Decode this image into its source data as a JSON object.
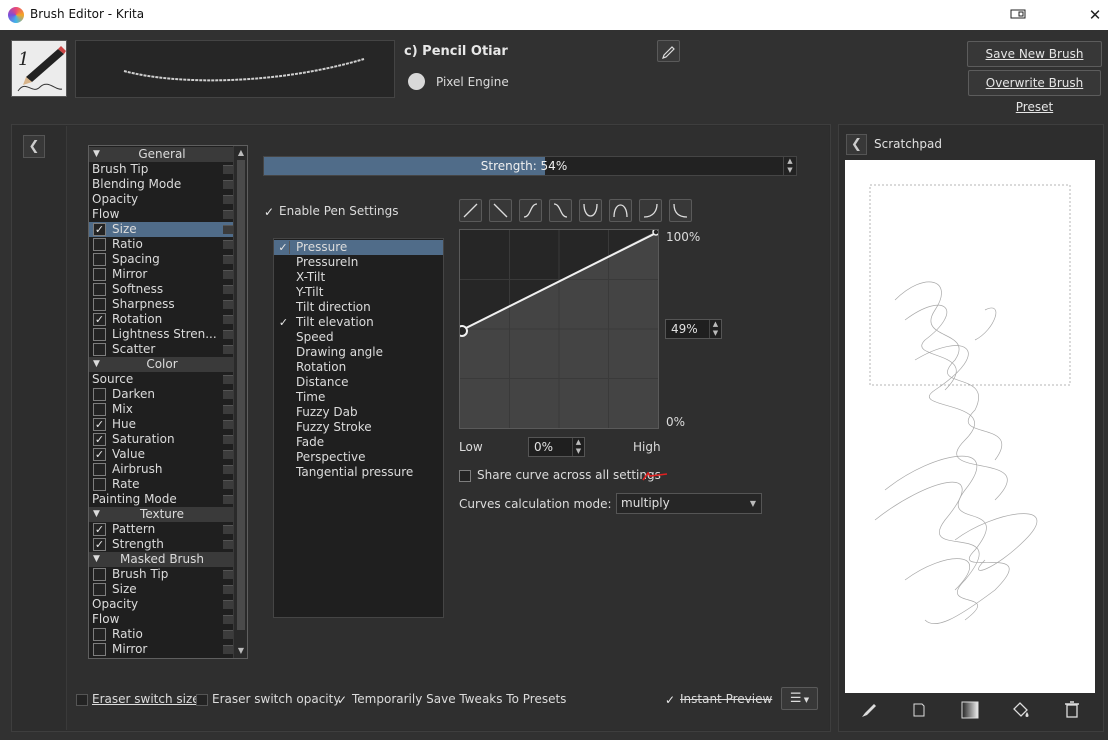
{
  "window": {
    "title": "Brush Editor - Krita"
  },
  "preset": {
    "name": "c) Pencil Otiar",
    "engine": "Pixel Engine",
    "save_new_label": "Save New Brush Preset...",
    "overwrite_label": "Overwrite Brush Preset"
  },
  "options": [
    {
      "type": "header",
      "label": "General"
    },
    {
      "type": "item",
      "label": "Brush Tip",
      "cb": null
    },
    {
      "type": "item",
      "label": "Blending Mode",
      "cb": null
    },
    {
      "type": "item",
      "label": "Opacity",
      "cb": null
    },
    {
      "type": "item",
      "label": "Flow",
      "cb": null
    },
    {
      "type": "item",
      "label": "Size",
      "cb": true,
      "selected": true
    },
    {
      "type": "item",
      "label": "Ratio",
      "cb": false
    },
    {
      "type": "item",
      "label": "Spacing",
      "cb": false
    },
    {
      "type": "item",
      "label": "Mirror",
      "cb": false
    },
    {
      "type": "item",
      "label": "Softness",
      "cb": false
    },
    {
      "type": "item",
      "label": "Sharpness",
      "cb": false
    },
    {
      "type": "item",
      "label": "Rotation",
      "cb": true
    },
    {
      "type": "item",
      "label": "Lightness Stren...",
      "cb": false
    },
    {
      "type": "item",
      "label": "Scatter",
      "cb": false
    },
    {
      "type": "header",
      "label": "Color"
    },
    {
      "type": "item",
      "label": "Source",
      "cb": null
    },
    {
      "type": "item",
      "label": "Darken",
      "cb": false
    },
    {
      "type": "item",
      "label": "Mix",
      "cb": false
    },
    {
      "type": "item",
      "label": "Hue",
      "cb": true
    },
    {
      "type": "item",
      "label": "Saturation",
      "cb": true
    },
    {
      "type": "item",
      "label": "Value",
      "cb": true
    },
    {
      "type": "item",
      "label": "Airbrush",
      "cb": false
    },
    {
      "type": "item",
      "label": "Rate",
      "cb": false
    },
    {
      "type": "item",
      "label": "Painting Mode",
      "cb": null
    },
    {
      "type": "header",
      "label": "Texture"
    },
    {
      "type": "item",
      "label": "Pattern",
      "cb": true
    },
    {
      "type": "item",
      "label": "Strength",
      "cb": true
    },
    {
      "type": "header",
      "label": "Masked Brush"
    },
    {
      "type": "item",
      "label": "Brush Tip",
      "cb": false
    },
    {
      "type": "item",
      "label": "Size",
      "cb": false
    },
    {
      "type": "item",
      "label": "Opacity",
      "cb": null
    },
    {
      "type": "item",
      "label": "Flow",
      "cb": null
    },
    {
      "type": "item",
      "label": "Ratio",
      "cb": false
    },
    {
      "type": "item",
      "label": "Mirror",
      "cb": false
    }
  ],
  "strength": {
    "text": "Strength: 54%",
    "value": 0.54
  },
  "pen": {
    "enable_label": "Enable Pen Settings",
    "enabled": true
  },
  "sensors": [
    {
      "label": "Pressure",
      "checked": true,
      "selected": true
    },
    {
      "label": "PressureIn",
      "checked": false
    },
    {
      "label": "X-Tilt",
      "checked": false
    },
    {
      "label": "Y-Tilt",
      "checked": false
    },
    {
      "label": "Tilt direction",
      "checked": false
    },
    {
      "label": "Tilt elevation",
      "checked": true
    },
    {
      "label": "Speed",
      "checked": false
    },
    {
      "label": "Drawing angle",
      "checked": false
    },
    {
      "label": "Rotation",
      "checked": false
    },
    {
      "label": "Distance",
      "checked": false
    },
    {
      "label": "Time",
      "checked": false
    },
    {
      "label": "Fuzzy Dab",
      "checked": false
    },
    {
      "label": "Fuzzy Stroke",
      "checked": false
    },
    {
      "label": "Fade",
      "checked": false
    },
    {
      "label": "Perspective",
      "checked": false
    },
    {
      "label": "Tangential pressure",
      "checked": false
    }
  ],
  "curve": {
    "max_label": "100%",
    "min_label": "0%",
    "mid_value": "49%",
    "start_y": 0.49,
    "low_label": "Low",
    "high_label": "High",
    "low_value": "0%",
    "share_label": "Share curve across all settings",
    "calc_label": "Curves calculation mode:",
    "calc_value": "multiply"
  },
  "bottom": {
    "eraser_size": "Eraser switch size",
    "eraser_opacity": "Eraser switch opacity",
    "temp_save": "Temporarily Save Tweaks To Presets",
    "instant_preview": "Instant Preview"
  },
  "scratchpad": {
    "title": "Scratchpad"
  }
}
